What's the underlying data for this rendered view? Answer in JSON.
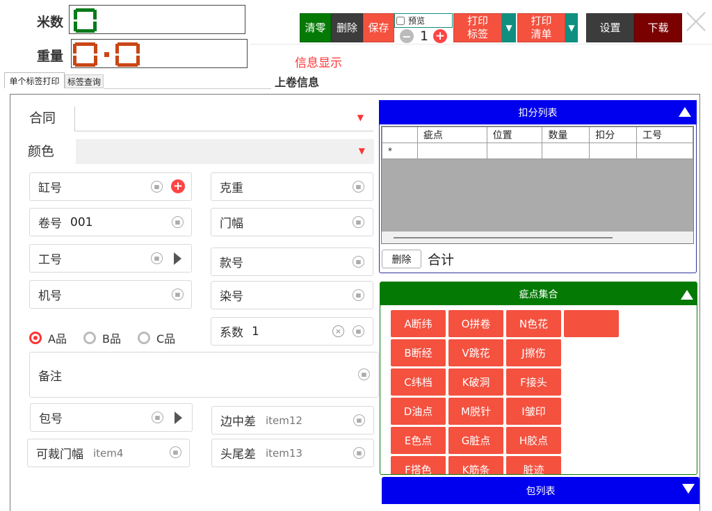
{
  "header": {
    "meter_label": "米数",
    "weight_label": "重量",
    "info_display": "信息显示",
    "roll_info_title": "上卷信息",
    "meter_digits": "0",
    "weight_digits": "0.0"
  },
  "toolbar": {
    "clear": "清零",
    "delete": "删除",
    "save": "保存",
    "preview_label": "预览",
    "preview_checked": false,
    "copies": "1",
    "print_label": "打印\n标签",
    "print_list": "打印\n清单",
    "settings": "设置",
    "download": "下载"
  },
  "tabs": [
    {
      "label": "单个标签打印",
      "active": true
    },
    {
      "label": "标签查询",
      "active": false
    }
  ],
  "form": {
    "contract_label": "合同",
    "color_label": "颜色",
    "vat_label": "缸号",
    "gram_label": "克重",
    "roll_label": "卷号",
    "roll_value": "001",
    "width_label": "门幅",
    "worker_label": "工号",
    "style_label": "款号",
    "machine_label": "机号",
    "dye_label": "染号",
    "coef_label": "系数",
    "coef_value": "1",
    "grades": [
      {
        "label": "A品",
        "checked": true
      },
      {
        "label": "B品",
        "checked": false
      },
      {
        "label": "C品",
        "checked": false
      }
    ],
    "remark_label": "备注",
    "pack_label": "包号",
    "edge_label": "边中差",
    "edge_placeholder": "item12",
    "cut_width_label": "可裁门幅",
    "cut_width_placeholder": "item4",
    "headtail_label": "头尾差",
    "headtail_placeholder": "item13"
  },
  "deduction_panel": {
    "title": "扣分列表",
    "columns": [
      "疵点",
      "位置",
      "数量",
      "扣分",
      "工号"
    ],
    "new_row_marker": "*",
    "delete_button": "删除",
    "total_label": "合计"
  },
  "defect_panel": {
    "title": "疵点集合",
    "items": [
      "A断纬",
      "O拼卷",
      "N色花",
      "",
      "B断经",
      "V跳花",
      "J擦伤",
      "C纬档",
      "K破洞",
      "F接头",
      "D油点",
      "M脱针",
      "I皱印",
      "E色点",
      "G脏点",
      "H胶点",
      "F搭色",
      "K筋条",
      "脏迹"
    ]
  },
  "package_panel": {
    "title": "包列表"
  },
  "colors": {
    "green": "#047a04",
    "dark": "#3c3c3c",
    "red": "#f4513f",
    "teal": "#0f8f80",
    "maroon": "#7b0000",
    "blue": "#0000ee",
    "seg_green": "#0a7a1a",
    "seg_orange": "#c84614"
  }
}
